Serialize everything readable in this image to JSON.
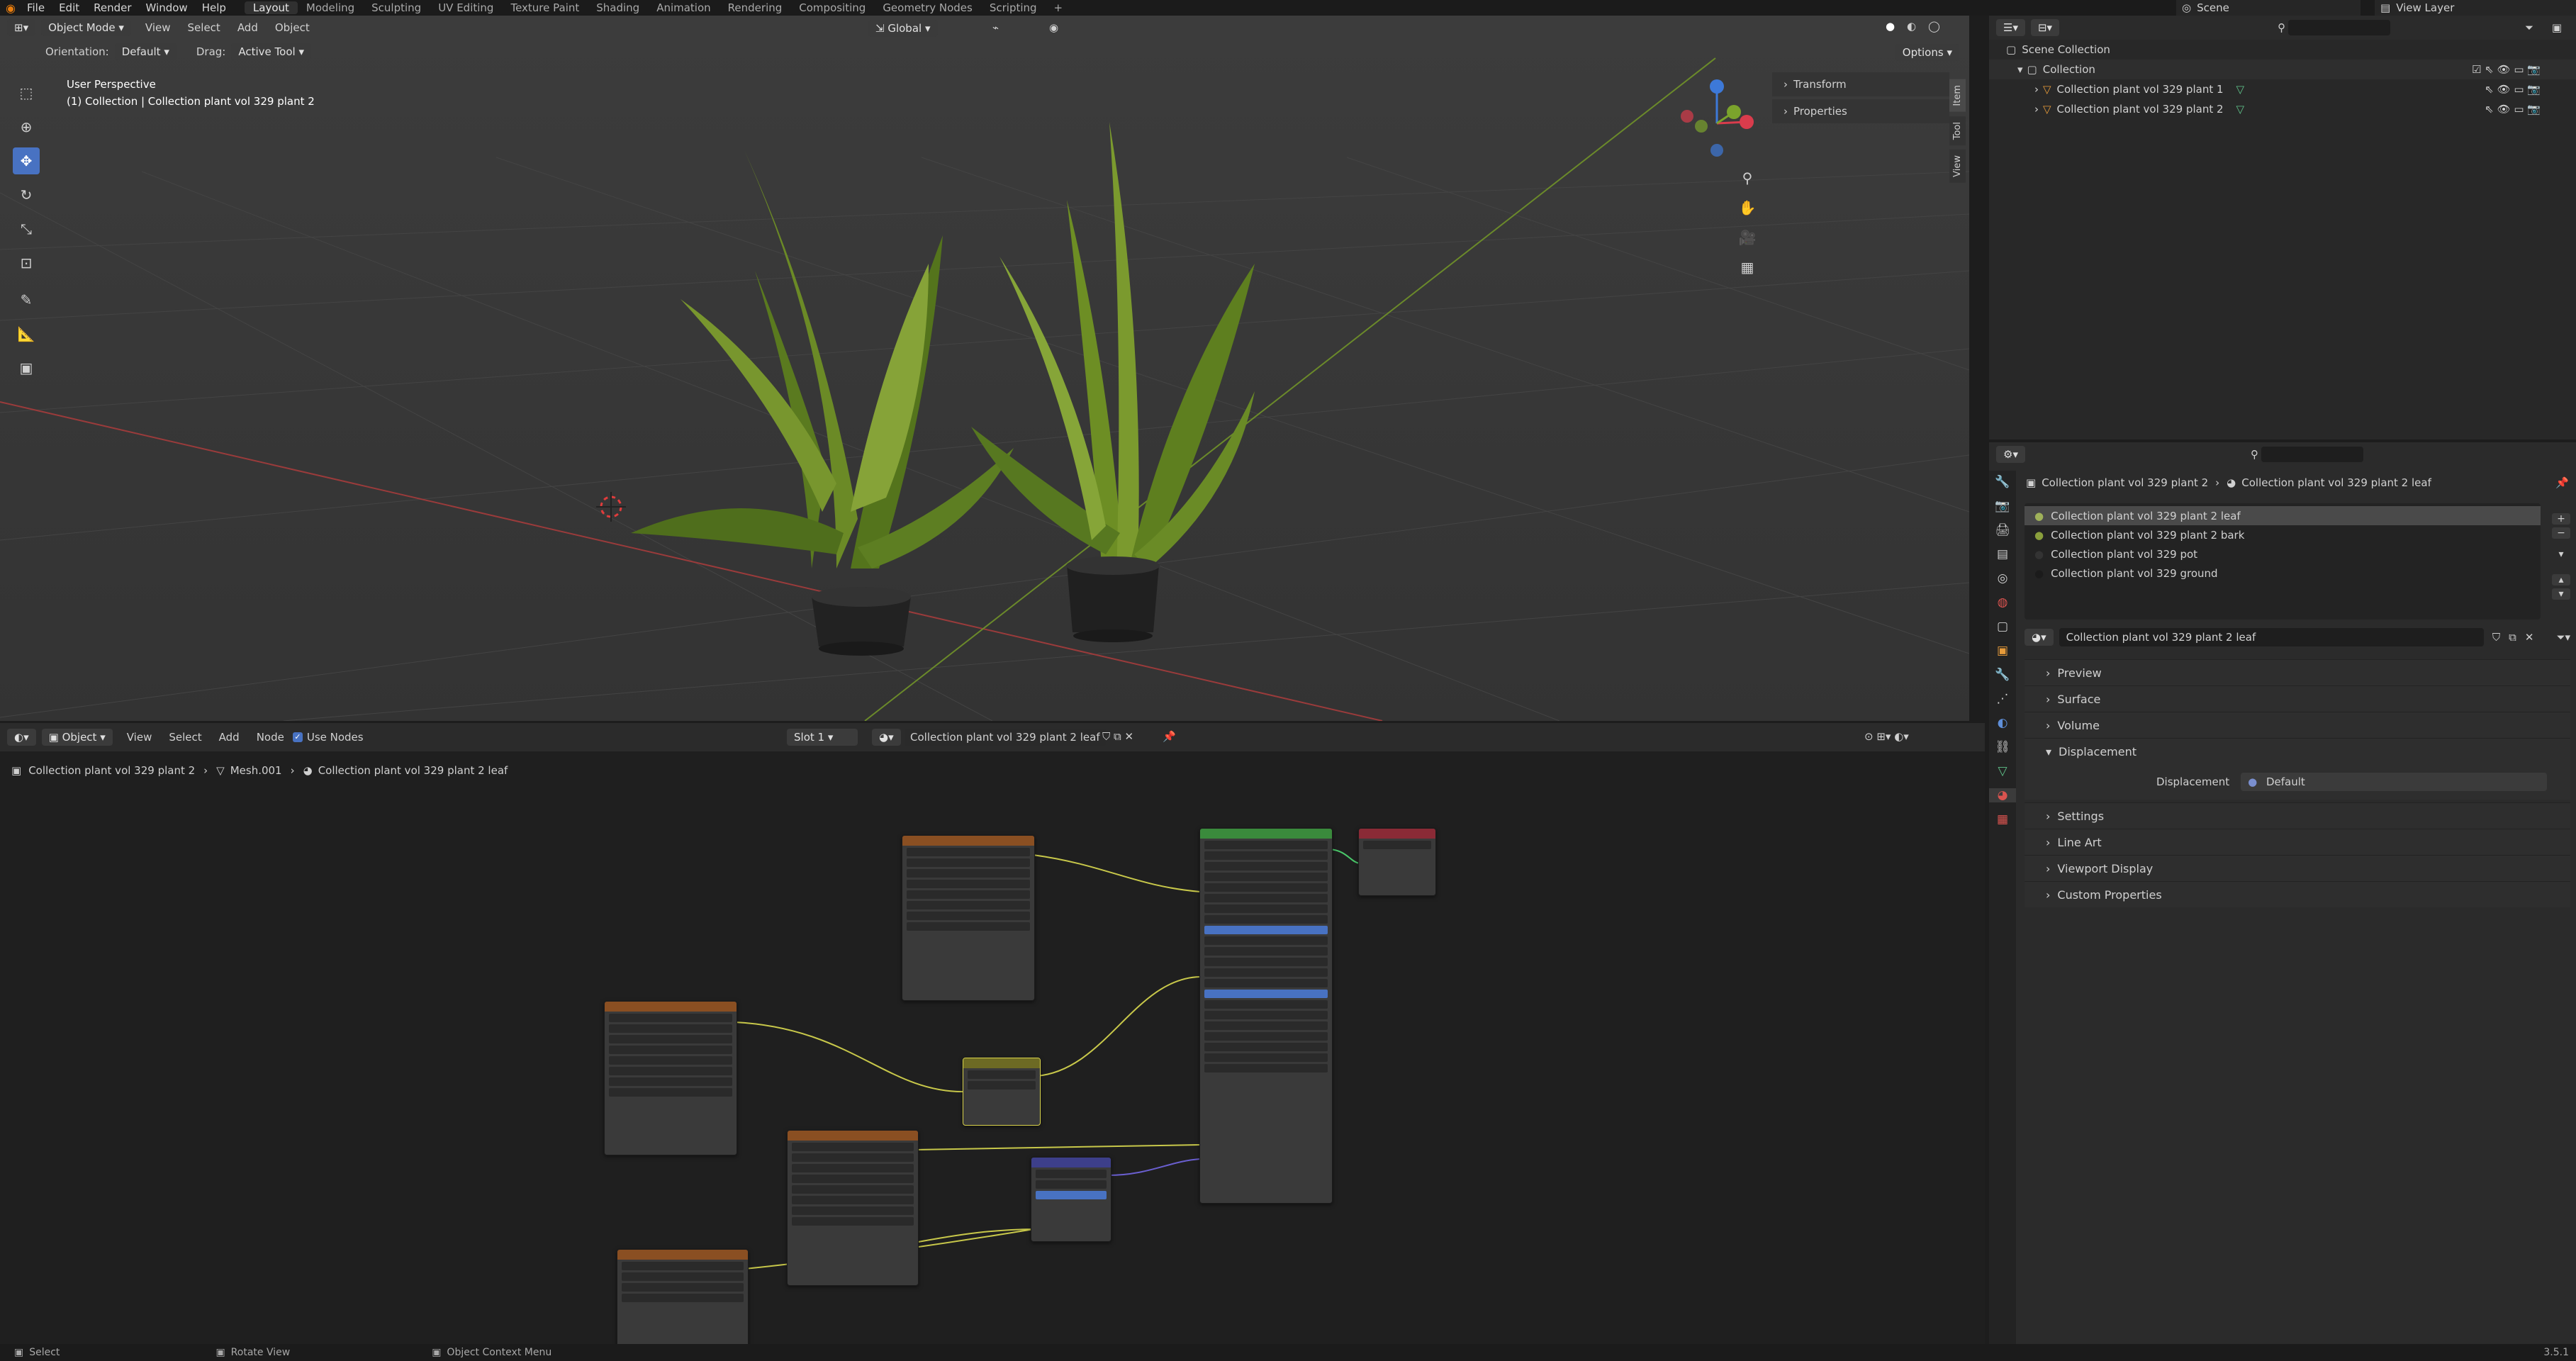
{
  "topbar": {
    "menus": [
      "File",
      "Edit",
      "Render",
      "Window",
      "Help"
    ],
    "workspaces": [
      "Layout",
      "Modeling",
      "Sculpting",
      "UV Editing",
      "Texture Paint",
      "Shading",
      "Animation",
      "Rendering",
      "Compositing",
      "Geometry Nodes",
      "Scripting"
    ],
    "active_workspace": "Layout",
    "scene": "Scene",
    "view_layer": "View Layer"
  },
  "viewport": {
    "mode": "Object Mode",
    "menus": [
      "View",
      "Select",
      "Add",
      "Object"
    ],
    "orientation_label": "Orientation:",
    "orientation_value": "Default",
    "drag_label": "Drag:",
    "drag_value": "Active Tool",
    "transform_space": "Global",
    "options": "Options",
    "title": "User Perspective",
    "subtitle": "(1) Collection | Collection plant vol 329 plant 2",
    "sidebar_panels": [
      "Transform",
      "Properties"
    ],
    "side_tabs": [
      "Item",
      "Tool",
      "View"
    ]
  },
  "outliner": {
    "root": "Scene Collection",
    "collection": "Collection",
    "items": [
      "Collection plant vol 329 plant 1",
      "Collection plant vol 329 plant 2"
    ]
  },
  "properties": {
    "breadcrumb_object": "Collection plant vol 329 plant 2",
    "breadcrumb_material": "Collection plant vol 329 plant 2 leaf",
    "slots": [
      "Collection plant vol 329 plant 2 leaf",
      "Collection plant vol 329 plant 2 bark",
      "Collection plant vol 329 pot",
      "Collection plant vol 329 ground"
    ],
    "material_name": "Collection plant vol 329 plant 2 leaf",
    "panels": [
      "Preview",
      "Surface",
      "Volume",
      "Displacement",
      "Settings",
      "Line Art",
      "Viewport Display",
      "Custom Properties"
    ],
    "displacement_label": "Displacement",
    "displacement_value": "Default"
  },
  "node_editor": {
    "object_dd": "Object",
    "menus": [
      "View",
      "Select",
      "Add",
      "Node"
    ],
    "use_nodes": "Use Nodes",
    "slot": "Slot 1",
    "material": "Collection plant vol 329 plant 2 leaf",
    "crumb_object": "Collection plant vol 329 plant 2",
    "crumb_mesh": "Mesh.001",
    "crumb_material": "Collection plant vol 329 plant 2 leaf"
  },
  "status": {
    "select": "Select",
    "rotate": "Rotate View",
    "context": "Object Context Menu",
    "version": "3.5.1"
  }
}
